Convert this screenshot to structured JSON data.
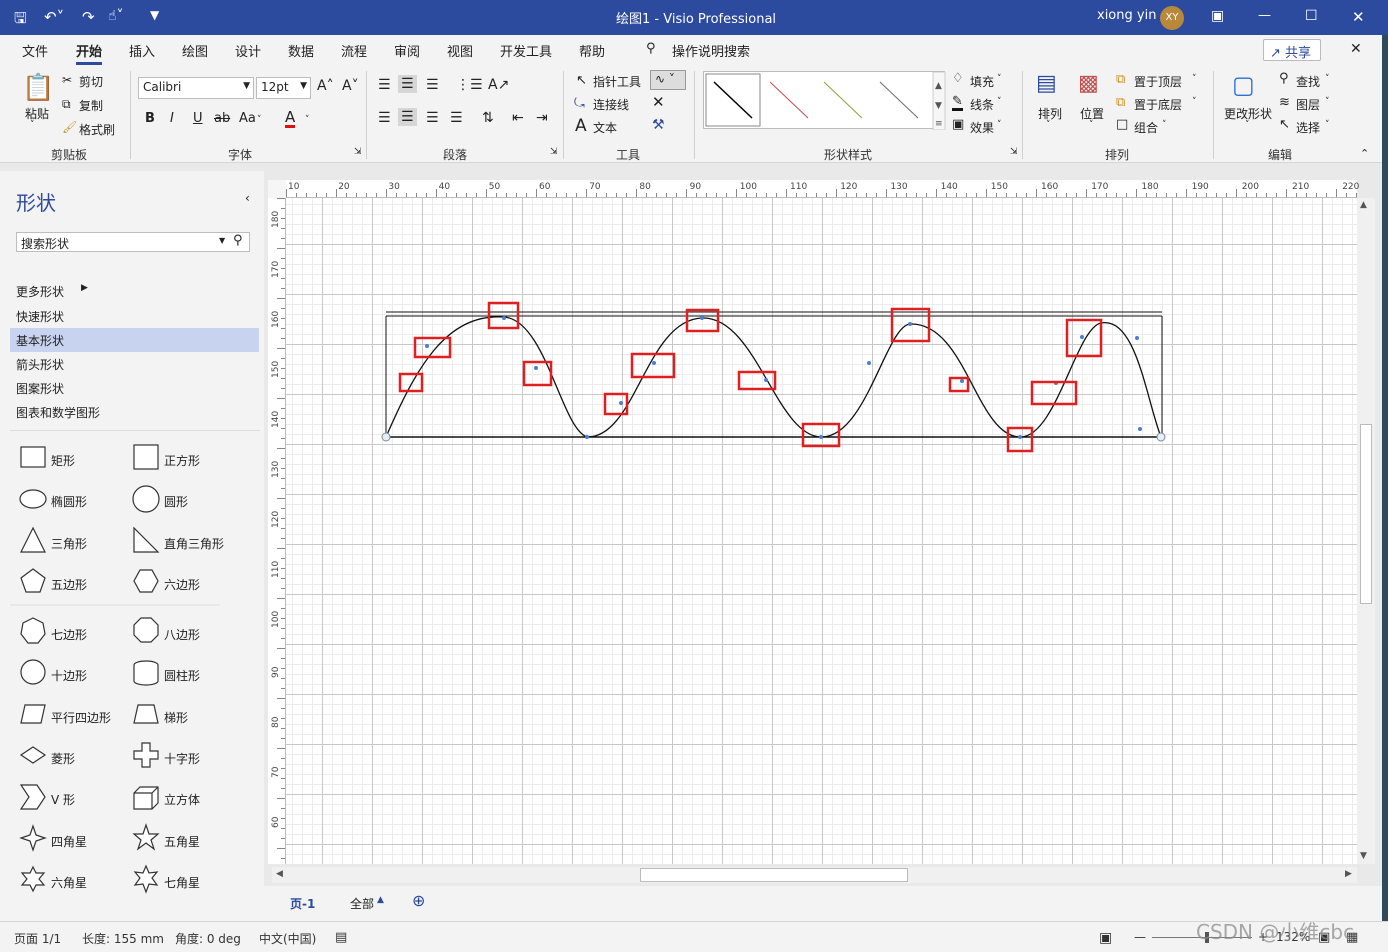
{
  "title": "绘图1  -  Visio Professional",
  "user": {
    "name": "xiong yin",
    "initials": "XY"
  },
  "tabs": [
    "文件",
    "开始",
    "插入",
    "绘图",
    "设计",
    "数据",
    "流程",
    "审阅",
    "视图",
    "开发工具",
    "帮助"
  ],
  "tell_me": "操作说明搜索",
  "share": "共享",
  "ribbon": {
    "clipboard": {
      "paste": "粘贴",
      "cut": "剪切",
      "copy": "复制",
      "format_painter": "格式刷",
      "group": "剪贴板"
    },
    "font": {
      "name": "Calibri",
      "size": "12pt",
      "grow": "A˄",
      "shrink": "A˅",
      "bold": "B",
      "italic": "I",
      "underline": "U",
      "strike": "ab",
      "case": "Aa",
      "color_letter": "A",
      "group": "字体"
    },
    "paragraph": {
      "group": "段落"
    },
    "tools": {
      "pointer": "指针工具",
      "connector": "连接线",
      "text": "文本",
      "group": "工具"
    },
    "shape_styles": {
      "fill": "填充",
      "line": "线条",
      "effects": "效果",
      "group": "形状样式"
    },
    "arrange": {
      "align": "排列",
      "position": "位置",
      "front": "置于顶层",
      "back": "置于底层",
      "group_btn": "组合",
      "group": "排列"
    },
    "editing": {
      "change_shape": "更改形状",
      "find": "查找",
      "layers": "图层",
      "select": "选择",
      "group": "编辑"
    }
  },
  "shapes_pane": {
    "title": "形状",
    "search_placeholder": "搜索形状",
    "menu": [
      "更多形状",
      "快速形状",
      "基本形状",
      "箭头形状",
      "图案形状",
      "图表和数学图形"
    ],
    "selected": "基本形状",
    "items": [
      "矩形",
      "正方形",
      "椭圆形",
      "圆形",
      "三角形",
      "直角三角形",
      "五边形",
      "六边形",
      "七边形",
      "八边形",
      "十边形",
      "圆柱形",
      "平行四边形",
      "梯形",
      "菱形",
      "十字形",
      "V 形",
      "立方体",
      "四角星",
      "五角星",
      "六角星",
      "七角星"
    ]
  },
  "ruler_top": [
    "10",
    "20",
    "30",
    "40",
    "50",
    "60",
    "70",
    "80",
    "90",
    "100",
    "110",
    "120",
    "130",
    "140",
    "150",
    "160",
    "170",
    "180",
    "190",
    "200",
    "210",
    "220"
  ],
  "ruler_left": [
    "180",
    "170",
    "160",
    "150",
    "140",
    "130",
    "120",
    "110",
    "100",
    "90",
    "80",
    "70",
    "60"
  ],
  "pages": {
    "page": "页-1",
    "all": "全部"
  },
  "status": {
    "page": "页面 1/1",
    "length": "长度: 155 mm",
    "angle": "角度: 0 deg",
    "lang": "中文(中国)",
    "zoom": "132%"
  },
  "watermark": "CSDN @小维cbc",
  "colors": {
    "title_bar": "#2c4a9e",
    "highlight": "#e02020",
    "selected_menu": "#c8d3f0"
  }
}
